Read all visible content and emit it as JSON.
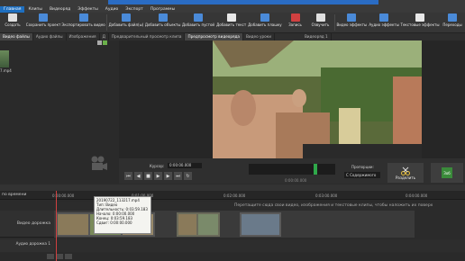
{
  "menu": [
    "Главная",
    "Клипы",
    "Видеоряд",
    "Эффекты",
    "Аудио",
    "Экспорт",
    "Программы"
  ],
  "ribbon": [
    {
      "label": "Создать",
      "icon": "new-project-icon",
      "color": "#e0e0e0"
    },
    {
      "label": "Сохранить проект",
      "icon": "save-icon",
      "color": "#4a8ad8"
    },
    {
      "label": "Экспортировать видео",
      "icon": "export-icon",
      "color": "#4a8ad8"
    },
    {
      "label": "Добавить файл(ы)",
      "icon": "add-file-icon",
      "color": "#4a8ad8"
    },
    {
      "label": "Добавить объекты",
      "icon": "add-objects-icon",
      "color": "#4a8ad8"
    },
    {
      "label": "Добавить пустой",
      "icon": "add-empty-icon",
      "color": "#4a8ad8"
    },
    {
      "label": "Добавить текст",
      "icon": "add-text-icon",
      "color": "#e8e8e8"
    },
    {
      "label": "Добавить плашку",
      "icon": "add-shape-icon",
      "color": "#4a8ad8"
    },
    {
      "label": "Запись",
      "icon": "record-icon",
      "color": "#d04040"
    },
    {
      "label": "Озвучить",
      "icon": "voiceover-icon",
      "color": "#e0e0e0"
    },
    {
      "label": "Видео эффекты",
      "icon": "video-effects-icon",
      "color": "#4a8ad8"
    },
    {
      "label": "Аудио эффекты",
      "icon": "audio-effects-icon",
      "color": "#4a8ad8"
    },
    {
      "label": "Текстовые эффекты",
      "icon": "text-effects-icon",
      "color": "#e8e8e8"
    },
    {
      "label": "Переходы",
      "icon": "transitions-icon",
      "color": "#4a8ad8"
    }
  ],
  "tabs": [
    "Видео файлы",
    "Аудио файлы",
    "Изображения",
    "Д",
    "Предварительный просмотр клипа",
    "Предпросмотр видеоряда",
    "Видео уроки",
    "Видеоряд 1"
  ],
  "media": {
    "file_label": "7.mp4"
  },
  "transport": {
    "cursor_label": "Курсор:",
    "cursor_value": "0:00:00.000",
    "scale_label": "Пропорции:",
    "scale_value": "С Содержимого",
    "split_label": "Разделить",
    "add_label": "Зоб",
    "timecode": "0:00:00.000"
  },
  "timeline": {
    "left_label": "по времени",
    "ticks": [
      "0:00:00.000",
      "0:01:00.000",
      "0:02:00.000",
      "0:03:00.000",
      "0:04:00.000"
    ],
    "hint": "Перетащите сюда свои видео, изображения и текстовые клипы, чтобы наложить их поверх",
    "video_track": "Видео дорожка",
    "audio_track": "Аудио дорожка 1"
  },
  "tooltip": {
    "lines": [
      "20190722_113217.mp4",
      "Тип: Видео",
      "Длительность: 0:03:59.183",
      "Начало: 0:00:00.000",
      "Конец: 0:03:59.183",
      "Сдвиг: 0:00:00.000"
    ]
  },
  "colors": {
    "accent": "#1e6fc0",
    "playhead": "#d04040",
    "scrub_marker": "#2fa84a"
  }
}
